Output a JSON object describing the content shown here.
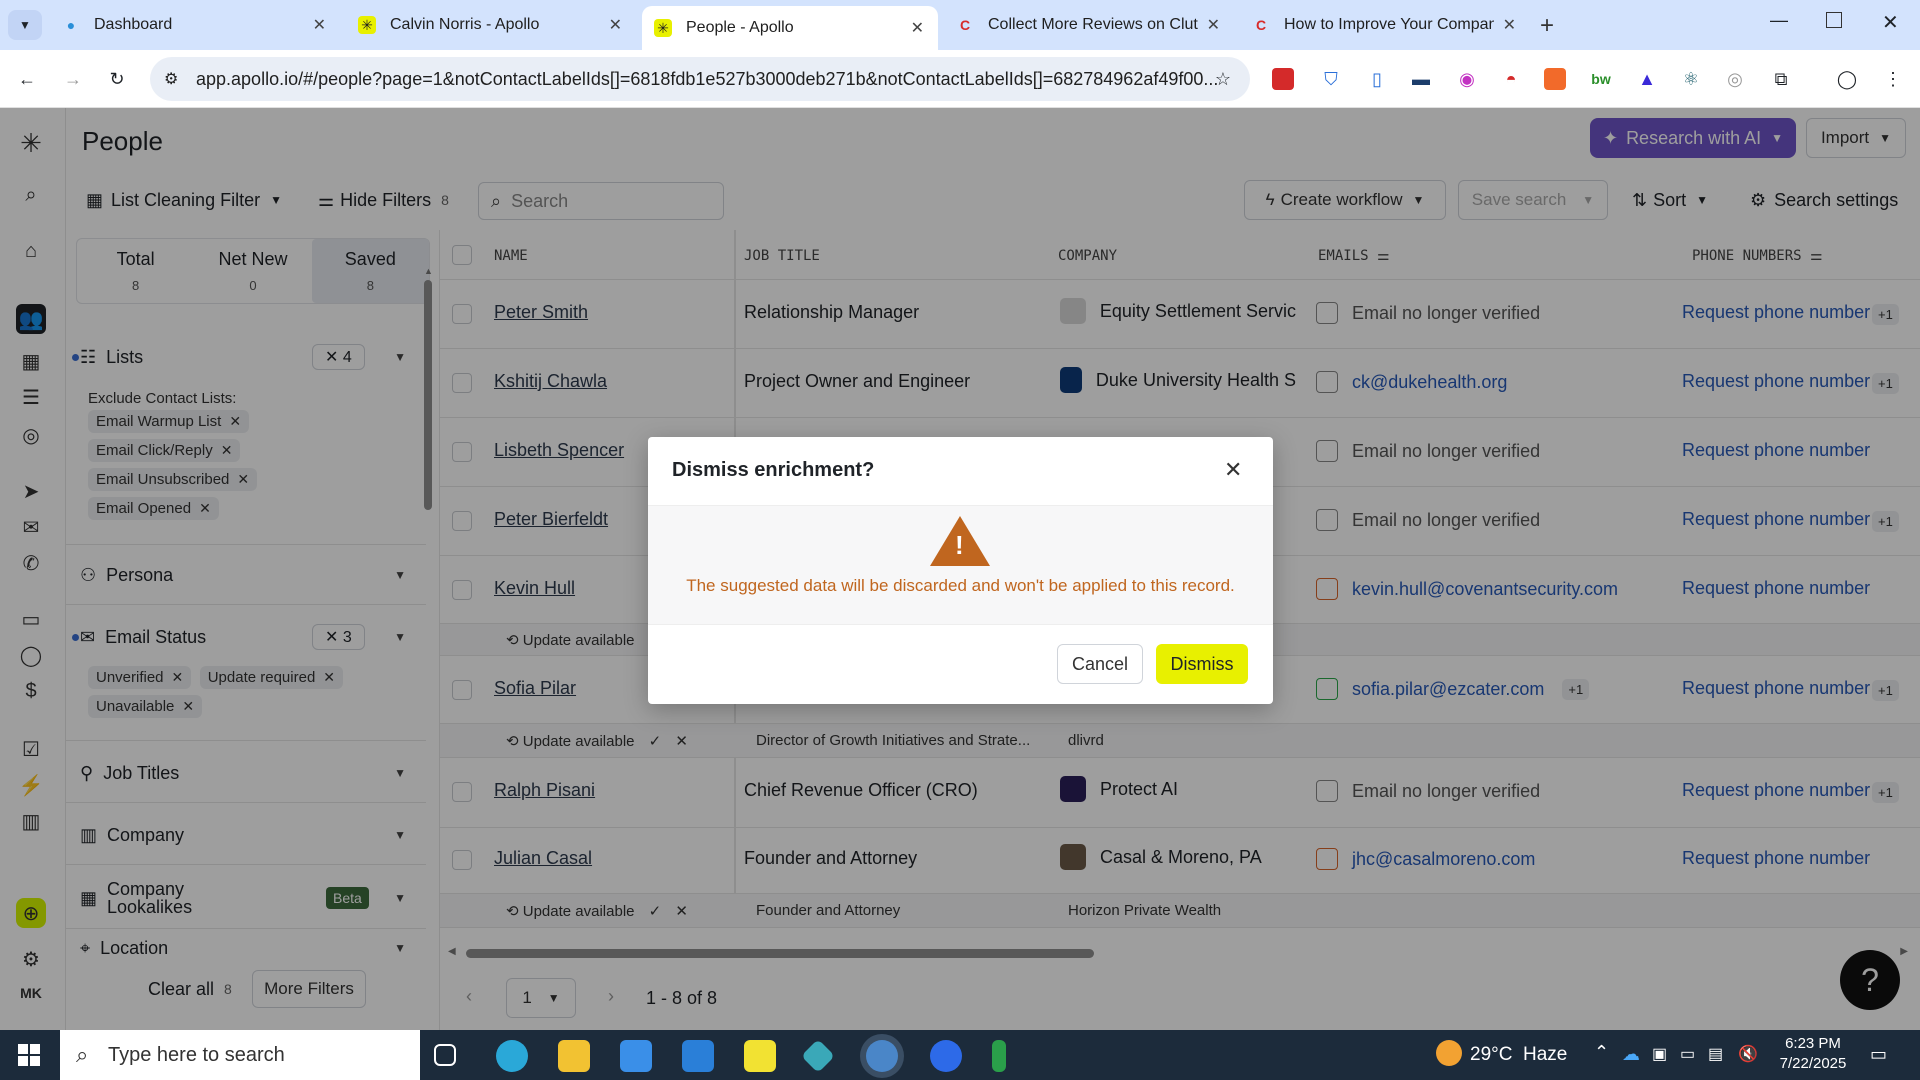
{
  "browser": {
    "tabs": [
      {
        "title": "Dashboard",
        "icon": "globe-icon",
        "active": false
      },
      {
        "title": "Calvin Norris - Apollo",
        "icon": "apollo-icon",
        "active": false
      },
      {
        "title": "People - Apollo",
        "icon": "apollo-icon",
        "active": true
      },
      {
        "title": "Collect More Reviews on Clutch",
        "icon": "clutch-icon",
        "active": false
      },
      {
        "title": "How to Improve Your Company",
        "icon": "clutch-icon",
        "active": false
      }
    ],
    "url": "app.apollo.io/#/people?page=1&notContactLabelIds[]=6818fdb1e527b3000deb271b&notContactLabelIds[]=682784962af49f00..."
  },
  "header": {
    "title": "People",
    "research_label": "Research with AI",
    "import_label": "Import"
  },
  "filterbar": {
    "list_filter": "List Cleaning Filter",
    "hide_filters": "Hide Filters",
    "hide_filters_count": "8",
    "search_placeholder": "Search",
    "create_workflow": "Create workflow",
    "save_search": "Save search",
    "sort": "Sort",
    "search_settings": "Search settings"
  },
  "sidebar": {
    "stats": [
      {
        "label": "Total",
        "value": "8"
      },
      {
        "label": "Net New",
        "value": "0"
      },
      {
        "label": "Saved",
        "value": "8"
      }
    ],
    "lists": {
      "label": "Lists",
      "count": "4",
      "exclude_label": "Exclude Contact Lists:",
      "chips": [
        "Email Warmup List",
        "Email Click/Reply",
        "Email Unsubscribed",
        "Email Opened"
      ]
    },
    "persona": "Persona",
    "email_status": {
      "label": "Email Status",
      "count": "3",
      "chips": [
        "Unverified",
        "Update required",
        "Unavailable"
      ]
    },
    "job_titles": "Job Titles",
    "company": "Company",
    "lookalikes": {
      "label_line1": "Company",
      "label_line2": "Lookalikes",
      "badge": "Beta"
    },
    "location": "Location",
    "clear_all": "Clear all",
    "clear_all_count": "8",
    "more_filters": "More Filters"
  },
  "table": {
    "columns": [
      "NAME",
      "JOB TITLE",
      "COMPANY",
      "EMAILS",
      "PHONE NUMBERS"
    ],
    "rows": [
      {
        "name": "Peter Smith",
        "title": "Relationship Manager",
        "company": "Equity Settlement Servic",
        "email": "Email no longer verified",
        "phone": "Request phone number",
        "extra": "+1"
      },
      {
        "name": "Kshitij Chawla",
        "title": "Project Owner and Engineer",
        "company": "Duke University Health S",
        "email": "ck@dukehealth.org",
        "phone": "Request phone number",
        "extra": "+1"
      },
      {
        "name": "Lisbeth Spencer",
        "title": "",
        "company": "",
        "email": "Email no longer verified",
        "phone": "Request phone number",
        "extra": ""
      },
      {
        "name": "Peter Bierfeldt",
        "title": "",
        "company": "",
        "email": "Email no longer verified",
        "phone": "Request phone number",
        "extra": "+1"
      },
      {
        "name": "Kevin Hull",
        "title": "",
        "company": "",
        "email": "kevin.hull@covenantsecurity.com",
        "phone": "Request phone number",
        "extra": ""
      },
      {
        "name": "Sofia Pilar",
        "title": "",
        "company": "",
        "email": "sofia.pilar@ezcater.com",
        "email_extra": "+1",
        "phone": "Request phone number",
        "extra": "+1"
      },
      {
        "name": "Ralph Pisani",
        "title": "Chief Revenue Officer (CRO)",
        "company": "Protect AI",
        "email": "Email no longer verified",
        "phone": "Request phone number",
        "extra": "+1"
      },
      {
        "name": "Julian Casal",
        "title": "Founder and Attorney",
        "company": "Casal & Moreno, PA",
        "email": "jhc@casalmoreno.com",
        "phone": "Request phone number",
        "extra": ""
      }
    ],
    "update_label": "Update available",
    "sub_rows": [
      {
        "title": "",
        "company": ""
      },
      {
        "title": "Director of Growth Initiatives and Strate...",
        "company": "dlivrd"
      },
      {
        "title": "Founder and Attorney",
        "company": "Horizon Private Wealth"
      }
    ],
    "pagination": {
      "page": "1",
      "range": "1 - 8 of 8"
    }
  },
  "modal": {
    "title": "Dismiss enrichment?",
    "message": "The suggested data will be discarded and won't be applied to this record.",
    "cancel": "Cancel",
    "dismiss": "Dismiss",
    "warning_color": "#c0661f",
    "dismiss_color": "#e8f000"
  },
  "taskbar": {
    "search_placeholder": "Type here to search",
    "weather": "29°C  Haze",
    "time": "6:23 PM",
    "date": "7/22/2025"
  },
  "user_initials": "MK"
}
